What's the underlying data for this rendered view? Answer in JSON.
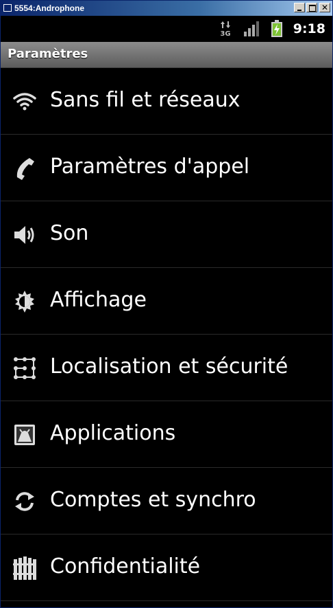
{
  "window": {
    "title": "5554:Androphone"
  },
  "statusbar": {
    "network": "3G",
    "time": "9:18"
  },
  "header": {
    "title": "Paramètres"
  },
  "settings": {
    "items": [
      {
        "label": "Sans fil et réseaux",
        "icon": "wifi-icon"
      },
      {
        "label": "Paramètres d'appel",
        "icon": "phone-icon"
      },
      {
        "label": "Son",
        "icon": "speaker-icon"
      },
      {
        "label": "Affichage",
        "icon": "brightness-icon"
      },
      {
        "label": "Localisation et sécurité",
        "icon": "unlock-pattern-icon"
      },
      {
        "label": "Applications",
        "icon": "applications-icon"
      },
      {
        "label": "Comptes et synchro",
        "icon": "sync-icon"
      },
      {
        "label": "Confidentialité",
        "icon": "privacy-fence-icon"
      }
    ]
  },
  "colors": {
    "titlebar_start": "#0a246a",
    "titlebar_end": "#a6caf0",
    "background": "#000000",
    "text": "#ffffff",
    "battery_charge": "#7ec234"
  }
}
